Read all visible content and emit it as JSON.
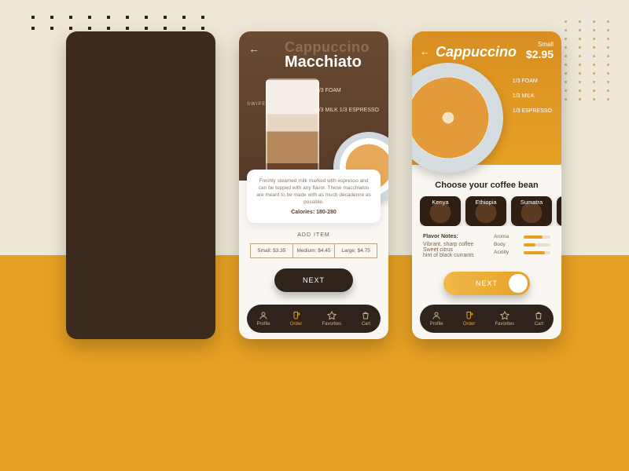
{
  "screen_macchiato": {
    "title_ghost": "Cappuccino",
    "title": "Macchiato",
    "swipe": "SWIPE >>",
    "layers": {
      "foam": "1/3\nFOAM",
      "milk": "1/3\nMILK",
      "espresso": "1/3\nESPRESSO"
    },
    "description": "Freshly steamed milk marked with espresso and can be topped with any flavor. These macchiatos are meant to be made with as much decadence as possible.",
    "calories": "Calories: 180-280",
    "add_item": "ADD ITEM",
    "sizes": {
      "small": "Small: $3.35",
      "medium": "Medium: $4.45",
      "large": "Large: $4.75"
    },
    "next": "NEXT"
  },
  "screen_cappuccino": {
    "title": "Cappuccino",
    "size_label": "Small",
    "price": "$2.95",
    "layers": {
      "foam": "1/3\nFOAM",
      "milk": "1/3\nMILK",
      "espresso": "1/3\nESPRESSO"
    },
    "choose_heading": "Choose your coffee bean",
    "beans": [
      "Kenya",
      "Ethiopia",
      "Sumatra"
    ],
    "flavor": {
      "heading": "Flavor Notes:",
      "lines": "Vibrant, sharp coffee\nSweet citrus\nhint of black currants",
      "meters": [
        {
          "label": "Aroma",
          "pct": 70
        },
        {
          "label": "Body",
          "pct": 45
        },
        {
          "label": "Acidity",
          "pct": 80
        }
      ]
    },
    "next": "NEXT"
  },
  "nav": {
    "profile": "Profile",
    "order": "Order",
    "favorites": "Favorites",
    "cart": "Cart"
  }
}
